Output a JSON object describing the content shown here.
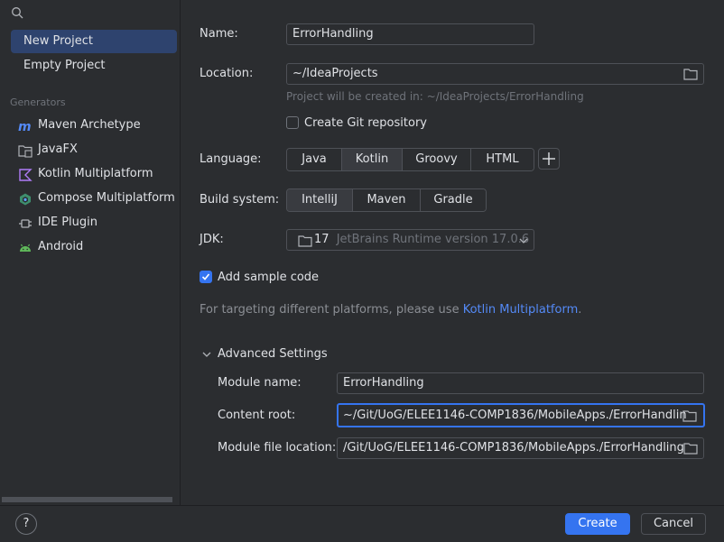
{
  "sidebar": {
    "project_types": [
      {
        "label": "New Project",
        "selected": true
      },
      {
        "label": "Empty Project",
        "selected": false
      }
    ],
    "generators_header": "Generators",
    "generators": [
      {
        "label": "Maven Archetype",
        "icon": "maven-icon"
      },
      {
        "label": "JavaFX",
        "icon": "javafx-icon"
      },
      {
        "label": "Kotlin Multiplatform",
        "icon": "kotlin-icon"
      },
      {
        "label": "Compose Multiplatform",
        "icon": "compose-icon"
      },
      {
        "label": "IDE Plugin",
        "icon": "plugin-icon"
      },
      {
        "label": "Android",
        "icon": "android-icon"
      }
    ]
  },
  "form": {
    "name_label": "Name:",
    "name_value": "ErrorHandling",
    "location_label": "Location:",
    "location_value": "~/IdeaProjects",
    "location_hint": "Project will be created in: ~/IdeaProjects/ErrorHandling",
    "git_label": "Create Git repository",
    "git_checked": false,
    "language_label": "Language:",
    "languages": [
      {
        "label": "Java",
        "selected": false
      },
      {
        "label": "Kotlin",
        "selected": true
      },
      {
        "label": "Groovy",
        "selected": false
      },
      {
        "label": "HTML",
        "selected": false
      }
    ],
    "plus_label": "+",
    "build_label": "Build system:",
    "build_systems": [
      {
        "label": "IntelliJ",
        "selected": true
      },
      {
        "label": "Maven",
        "selected": false
      },
      {
        "label": "Gradle",
        "selected": false
      }
    ],
    "jdk_label": "JDK:",
    "jdk_version": "17",
    "jdk_name": "JetBrains Runtime version 17.0.6",
    "sample_label": "Add sample code",
    "sample_checked": true,
    "targeting_text": "For targeting different platforms, please use ",
    "targeting_link": "Kotlin Multiplatform",
    "targeting_end": "."
  },
  "advanced": {
    "title": "Advanced Settings",
    "module_name_label": "Module name:",
    "module_name_value": "ErrorHandling",
    "content_root_label": "Content root:",
    "content_root_value": "~/Git/UoG/ELEE1146-COMP1836/MobileApps./ErrorHandlin",
    "module_file_label": "Module file location:",
    "module_file_value": "/Git/UoG/ELEE1146-COMP1836/MobileApps./ErrorHandling"
  },
  "footer": {
    "help_label": "?",
    "create_label": "Create",
    "cancel_label": "Cancel"
  },
  "colors": {
    "accent": "#3574f0",
    "selected_bg": "#2e436e",
    "link": "#548af7"
  }
}
